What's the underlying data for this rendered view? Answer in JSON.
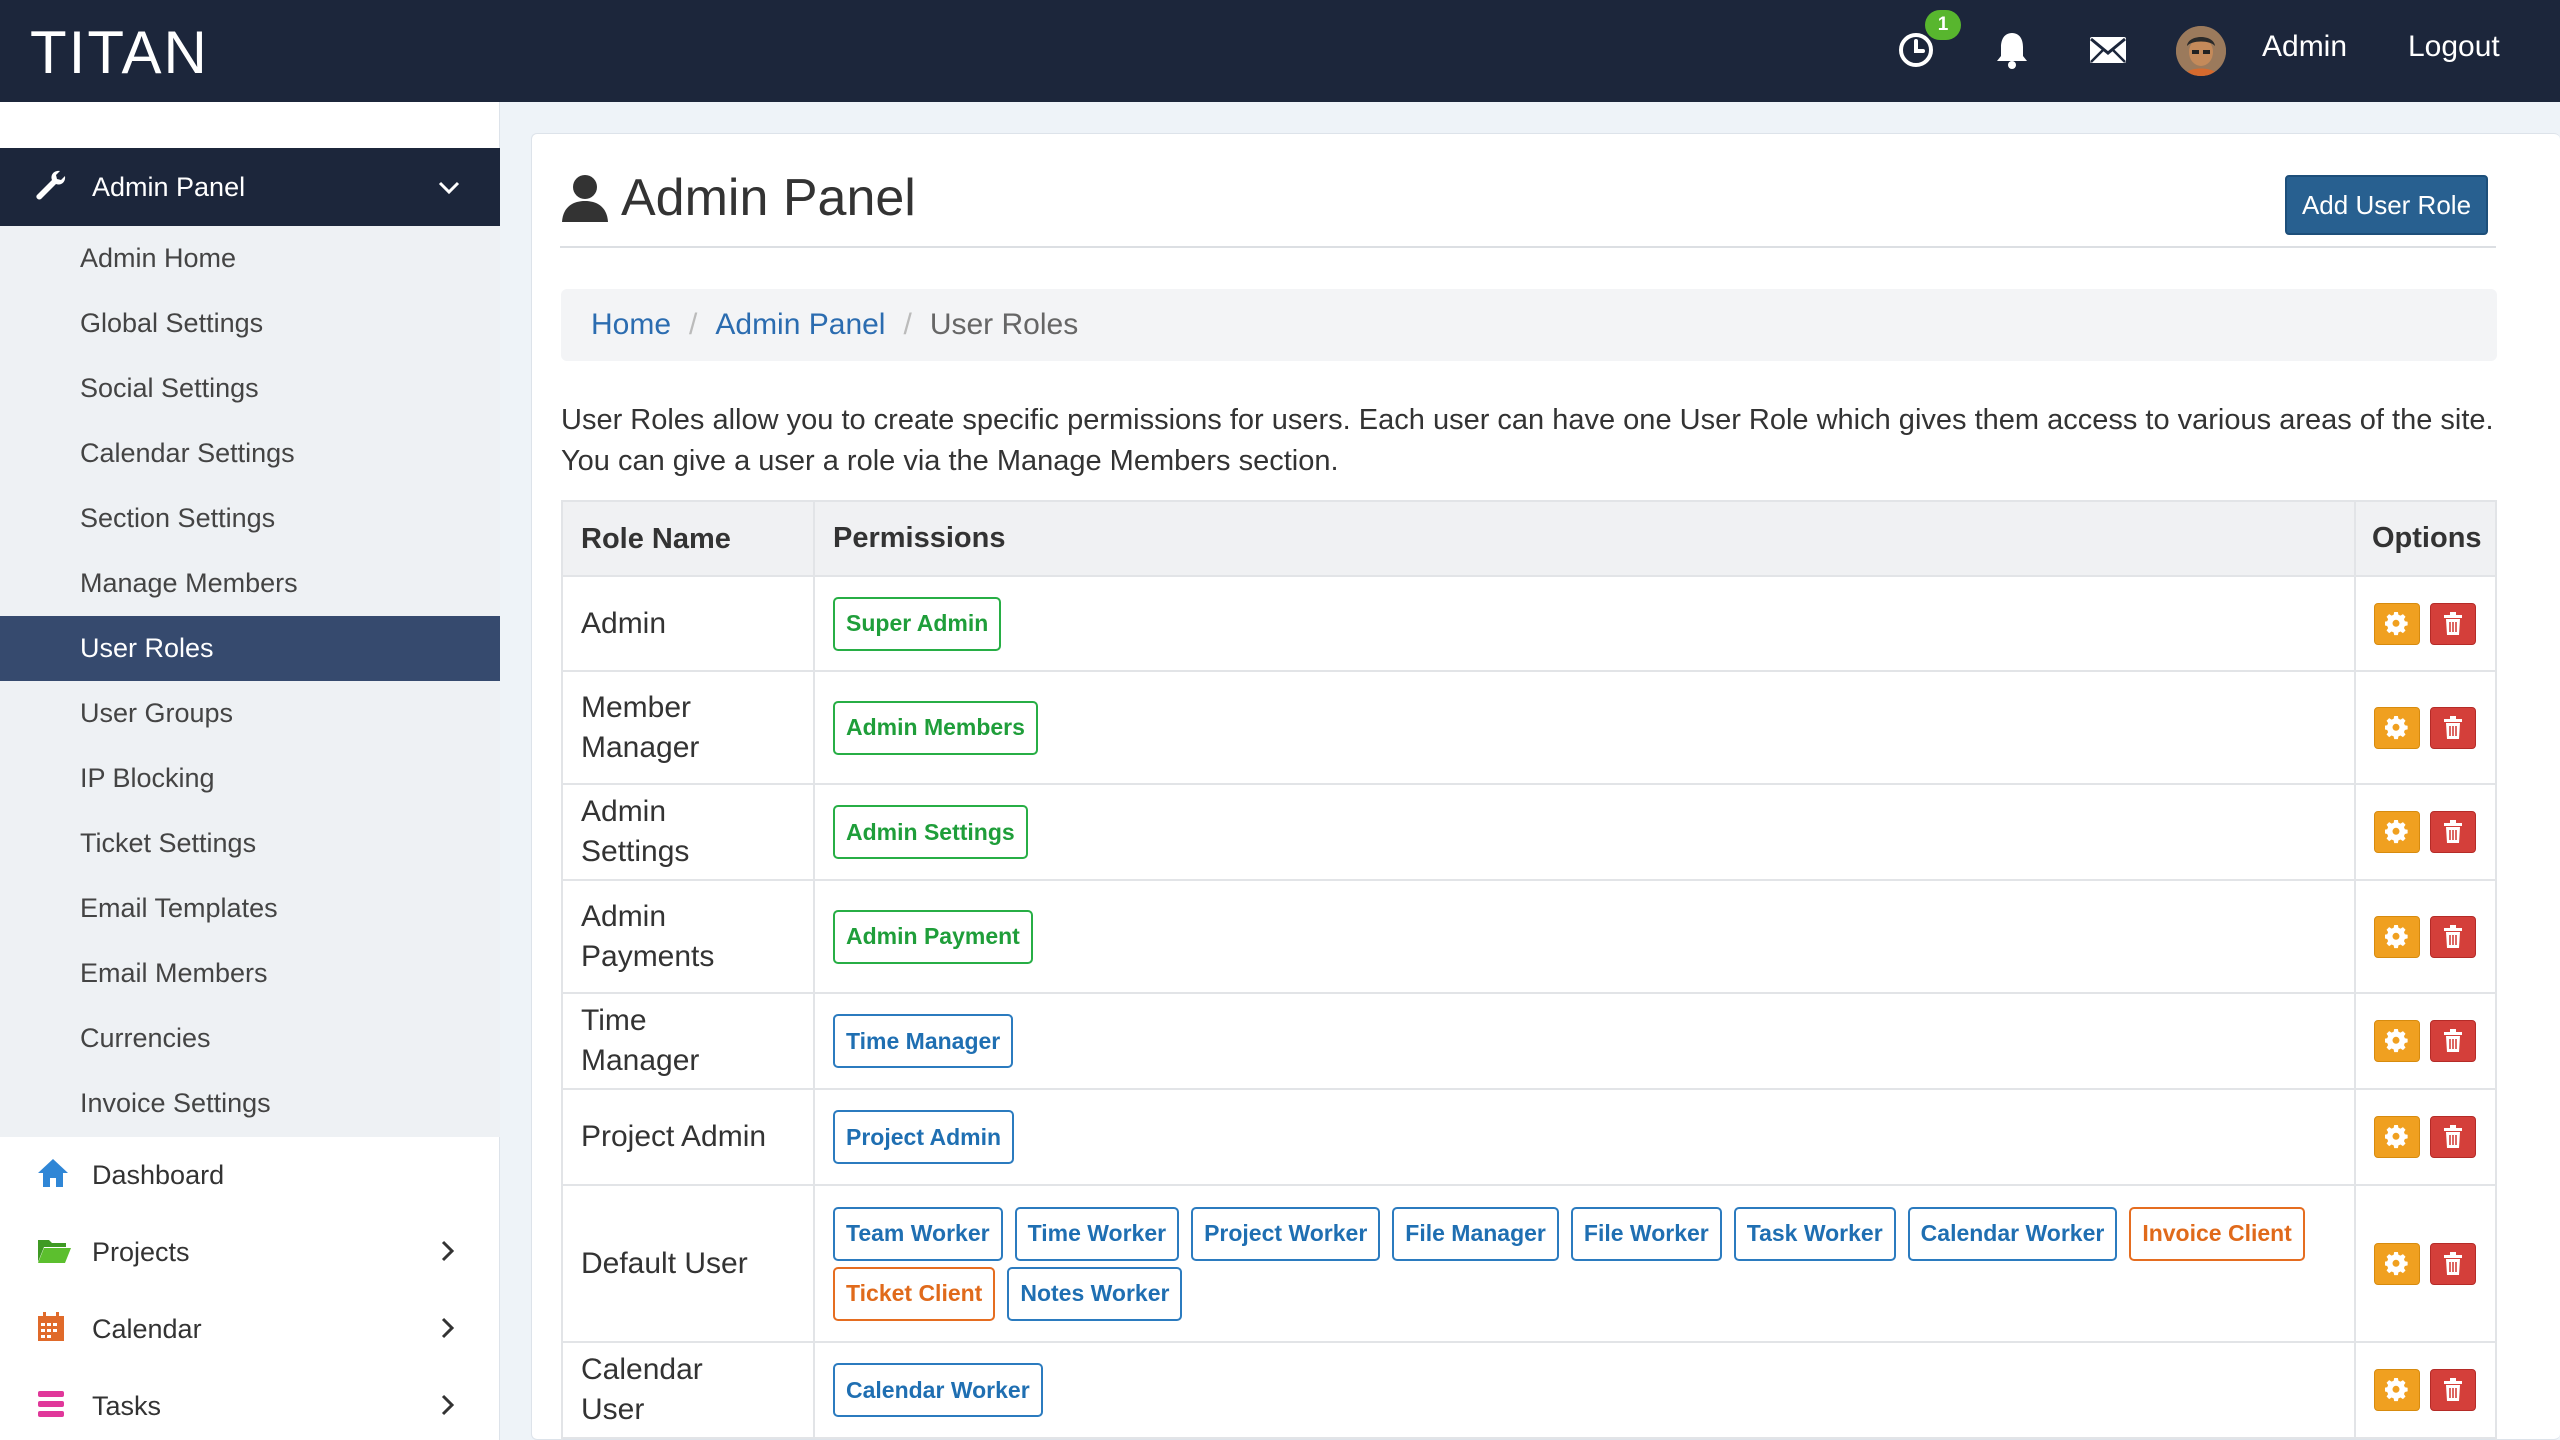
{
  "topbar": {
    "brand": "TITAN",
    "notification_count": "1",
    "user_label": "Admin",
    "logout_label": "Logout"
  },
  "sidebar": {
    "section_label": "Admin Panel",
    "sub_items": [
      {
        "label": "Admin Home",
        "active": false
      },
      {
        "label": "Global Settings",
        "active": false
      },
      {
        "label": "Social Settings",
        "active": false
      },
      {
        "label": "Calendar Settings",
        "active": false
      },
      {
        "label": "Section Settings",
        "active": false
      },
      {
        "label": "Manage Members",
        "active": false
      },
      {
        "label": "User Roles",
        "active": true
      },
      {
        "label": "User Groups",
        "active": false
      },
      {
        "label": "IP Blocking",
        "active": false
      },
      {
        "label": "Ticket Settings",
        "active": false
      },
      {
        "label": "Email Templates",
        "active": false
      },
      {
        "label": "Email Members",
        "active": false
      },
      {
        "label": "Currencies",
        "active": false
      },
      {
        "label": "Invoice Settings",
        "active": false
      }
    ],
    "main_items": [
      {
        "label": "Dashboard",
        "icon": "home-icon",
        "color": "#2f86d6",
        "has_chevron": false
      },
      {
        "label": "Projects",
        "icon": "folder-icon",
        "color": "#4caf2f",
        "has_chevron": true
      },
      {
        "label": "Calendar",
        "icon": "calendar-icon",
        "color": "#e06a2a",
        "has_chevron": true
      },
      {
        "label": "Tasks",
        "icon": "tasks-icon",
        "color": "#e0389a",
        "has_chevron": true
      }
    ]
  },
  "main": {
    "title": "Admin Panel",
    "add_button_label": "Add User Role",
    "breadcrumb": {
      "home": "Home",
      "section": "Admin Panel",
      "current": "User Roles"
    },
    "description": "User Roles allow you to create specific permissions for users. Each user can have one User Role which gives them access to various areas of the site. You can give a user a role via the Manage Members section.",
    "table": {
      "headers": {
        "role": "Role Name",
        "permissions": "Permissions",
        "options": "Options"
      },
      "rows": [
        {
          "role": "Admin",
          "permissions": [
            {
              "label": "Super Admin",
              "color": "green"
            }
          ]
        },
        {
          "role": "Member Manager",
          "permissions": [
            {
              "label": "Admin Members",
              "color": "green"
            }
          ]
        },
        {
          "role": "Admin Settings",
          "permissions": [
            {
              "label": "Admin Settings",
              "color": "green"
            }
          ]
        },
        {
          "role": "Admin Payments",
          "permissions": [
            {
              "label": "Admin Payment",
              "color": "green"
            }
          ]
        },
        {
          "role": "Time Manager",
          "permissions": [
            {
              "label": "Time Manager",
              "color": "blue"
            }
          ]
        },
        {
          "role": "Project Admin",
          "permissions": [
            {
              "label": "Project Admin",
              "color": "blue"
            }
          ]
        },
        {
          "role": "Default User",
          "permissions": [
            {
              "label": "Team Worker",
              "color": "blue"
            },
            {
              "label": "Time Worker",
              "color": "blue"
            },
            {
              "label": "Project Worker",
              "color": "blue"
            },
            {
              "label": "File Manager",
              "color": "blue"
            },
            {
              "label": "File Worker",
              "color": "blue"
            },
            {
              "label": "Task Worker",
              "color": "blue"
            },
            {
              "label": "Calendar Worker",
              "color": "blue"
            },
            {
              "label": "Invoice Client",
              "color": "orange"
            },
            {
              "label": "Ticket Client",
              "color": "orange"
            },
            {
              "label": "Notes Worker",
              "color": "blue"
            }
          ]
        },
        {
          "role": "Calendar User",
          "permissions": [
            {
              "label": "Calendar Worker",
              "color": "blue"
            }
          ]
        }
      ]
    }
  }
}
